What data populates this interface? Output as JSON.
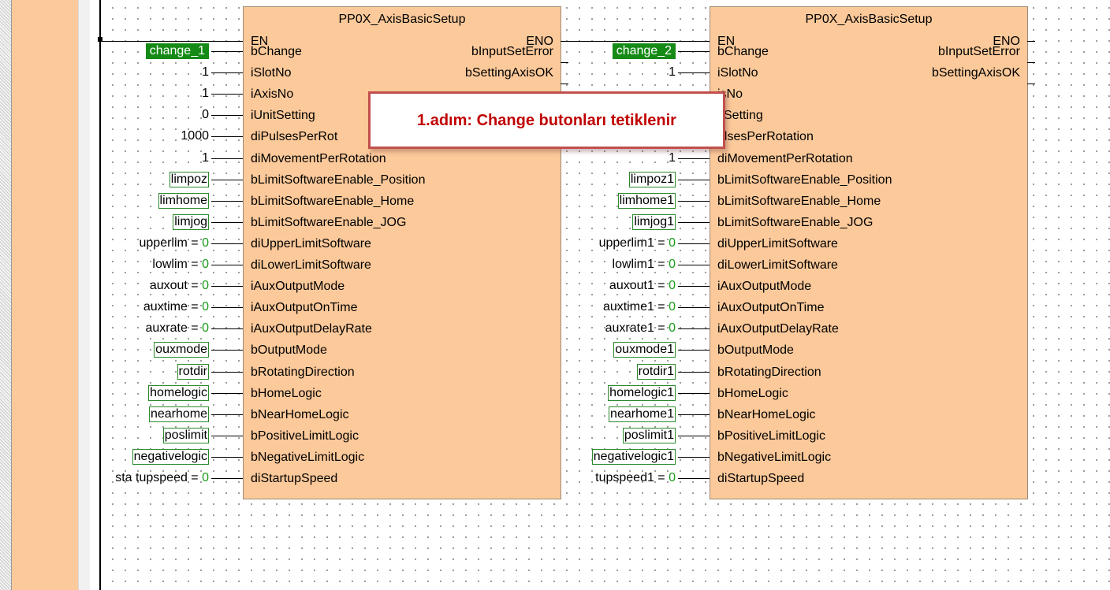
{
  "blocks": [
    {
      "title": "PP0X_AxisBasicSetup",
      "en": "EN",
      "eno": "ENO",
      "inputs": [
        "bChange",
        "iSlotNo",
        "iAxisNo",
        "iUnitSetting",
        "diPulsesPerRot",
        "diMovementPerRotation",
        "bLimitSoftwareEnable_Position",
        "bLimitSoftwareEnable_Home",
        "bLimitSoftwareEnable_JOG",
        "diUpperLimitSoftware",
        "diLowerLimitSoftware",
        "iAuxOutputMode",
        "iAuxOutputOnTime",
        "iAuxOutputDelayRate",
        "bOutputMode",
        "bRotatingDirection",
        "bHomeLogic",
        "bNearHomeLogic",
        "bPositiveLimitLogic",
        "bNegativeLimitLogic",
        "diStartupSpeed"
      ],
      "outputs": [
        "bInputSetError",
        "bSettingAxisOK"
      ],
      "variables": [
        {
          "text": "change_1",
          "value": ""
        },
        {
          "text": "1",
          "value": ""
        },
        {
          "text": "1",
          "value": ""
        },
        {
          "text": "0",
          "value": ""
        },
        {
          "text": "1000",
          "value": ""
        },
        {
          "text": "1",
          "value": ""
        },
        {
          "text": "limpoz",
          "value": ""
        },
        {
          "text": "limhome",
          "value": ""
        },
        {
          "text": "limjog",
          "value": ""
        },
        {
          "text": "upperlim = ",
          "value": "0"
        },
        {
          "text": "lowlim = ",
          "value": "0"
        },
        {
          "text": "auxout = ",
          "value": "0"
        },
        {
          "text": "auxtime = ",
          "value": "0"
        },
        {
          "text": "auxrate = ",
          "value": "0"
        },
        {
          "text": "ouxmode",
          "value": ""
        },
        {
          "text": "rotdir",
          "value": ""
        },
        {
          "text": "homelogic",
          "value": ""
        },
        {
          "text": "nearhome",
          "value": ""
        },
        {
          "text": "poslimit",
          "value": ""
        },
        {
          "text": "negativelogic",
          "value": ""
        },
        {
          "text": "sta tupspeed = ",
          "value": "0"
        }
      ]
    },
    {
      "title": "PP0X_AxisBasicSetup",
      "en": "EN",
      "eno": "ENO",
      "inputs": [
        "bChange",
        "iSlotNo",
        "isNo",
        "itSetting",
        "ulsesPerRotation",
        "diMovementPerRotation",
        "bLimitSoftwareEnable_Position",
        "bLimitSoftwareEnable_Home",
        "bLimitSoftwareEnable_JOG",
        "diUpperLimitSoftware",
        "diLowerLimitSoftware",
        "iAuxOutputMode",
        "iAuxOutputOnTime",
        "iAuxOutputDelayRate",
        "bOutputMode",
        "bRotatingDirection",
        "bHomeLogic",
        "bNearHomeLogic",
        "bPositiveLimitLogic",
        "bNegativeLimitLogic",
        "diStartupSpeed"
      ],
      "outputs": [
        "bInputSetError",
        "bSettingAxisOK"
      ],
      "variables": [
        {
          "text": "change_2",
          "value": ""
        },
        {
          "text": "1",
          "value": ""
        },
        {
          "text": "",
          "value": ""
        },
        {
          "text": "",
          "value": ""
        },
        {
          "text": "",
          "value": ""
        },
        {
          "text": "1",
          "value": ""
        },
        {
          "text": "limpoz1",
          "value": ""
        },
        {
          "text": "limhome1",
          "value": ""
        },
        {
          "text": "limjog1",
          "value": ""
        },
        {
          "text": "upperlim1 = ",
          "value": "0"
        },
        {
          "text": "lowlim1 = ",
          "value": "0"
        },
        {
          "text": "auxout1 = ",
          "value": "0"
        },
        {
          "text": "auxtime1 = ",
          "value": "0"
        },
        {
          "text": "auxrate1 = ",
          "value": "0"
        },
        {
          "text": "ouxmode1",
          "value": ""
        },
        {
          "text": "rotdir1",
          "value": ""
        },
        {
          "text": "homelogic1",
          "value": ""
        },
        {
          "text": "nearhome1",
          "value": ""
        },
        {
          "text": "poslimit1",
          "value": ""
        },
        {
          "text": "negativelogic1",
          "value": ""
        },
        {
          "text": "tupspeed1 = ",
          "value": "0"
        }
      ]
    }
  ],
  "callout": {
    "text": "1.adım: Change butonları tetiklenir",
    "color": "#c00000",
    "border_color": "#c0504d"
  },
  "colors": {
    "block_fill": "#fcc99a",
    "variable_border": "#2b8a2b",
    "active_variable_fill": "#158a15",
    "constant_value": "#1a9c1a"
  }
}
